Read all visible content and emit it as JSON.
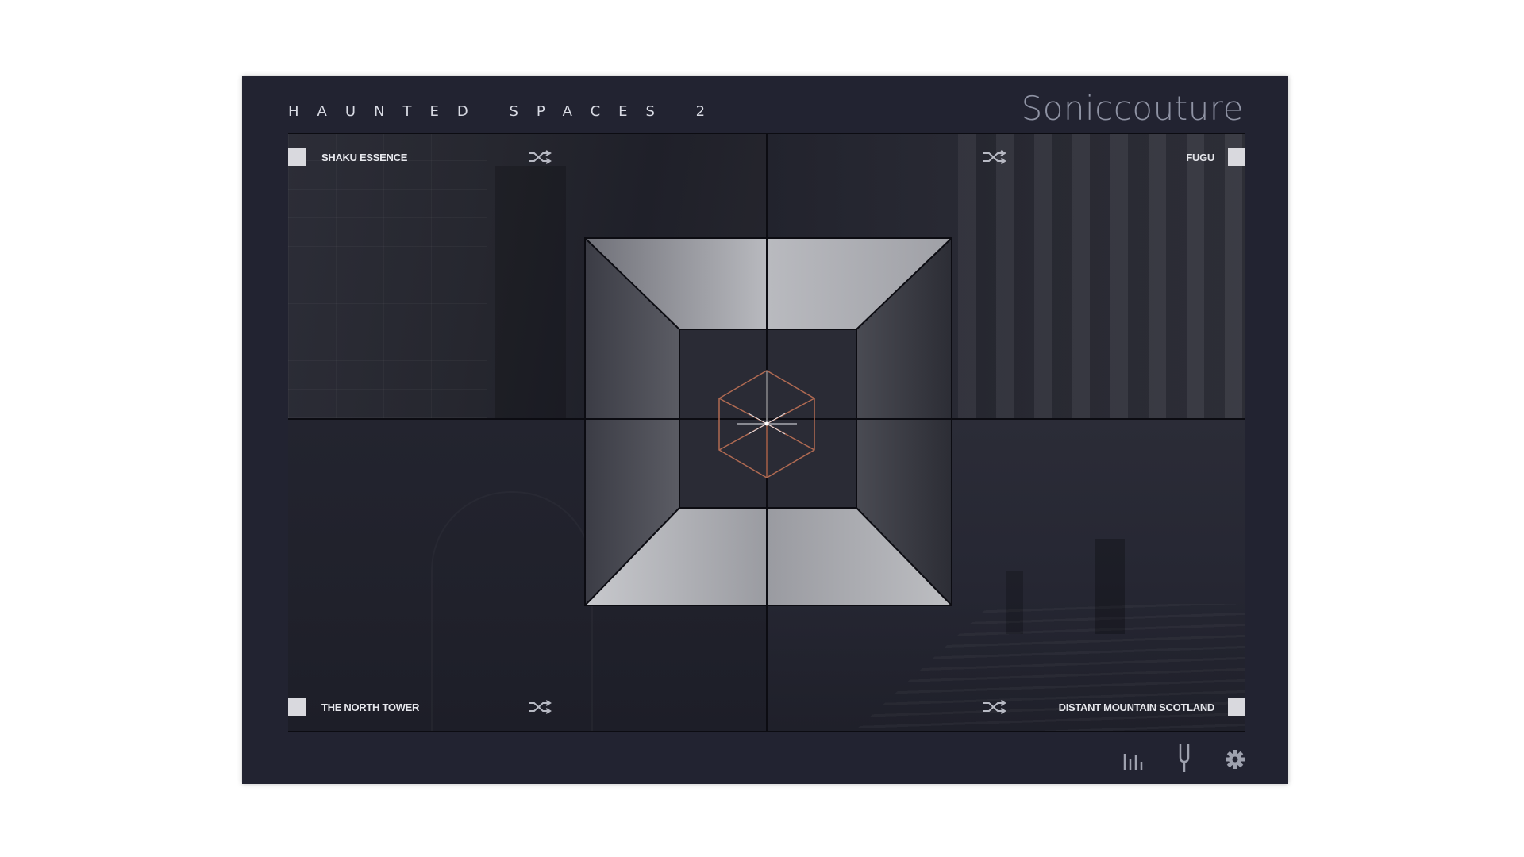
{
  "header": {
    "title": "HAUNTED SPACES 2",
    "brand": "Soniccouture"
  },
  "quadrants": {
    "top_left": {
      "label": "SHAKU ESSENCE",
      "enabled": true
    },
    "top_right": {
      "label": "FUGU",
      "enabled": true
    },
    "bottom_left": {
      "label": "THE NORTH TOWER",
      "enabled": true
    },
    "bottom_right": {
      "label": "DISTANT MOUNTAIN SCOTLAND",
      "enabled": true
    }
  },
  "icons": {
    "shuffle": "shuffle-icon",
    "mixer": "mixer-bars-icon",
    "tuning_fork": "tuning-fork-icon",
    "settings": "gear-icon",
    "center": "hexagon-cube-icon"
  },
  "colors": {
    "background": "#222331",
    "checkbox": "#d9d9de",
    "label": "#e6e7ec",
    "brand": "#8f93a4",
    "cube_accent": "#b06a52"
  }
}
